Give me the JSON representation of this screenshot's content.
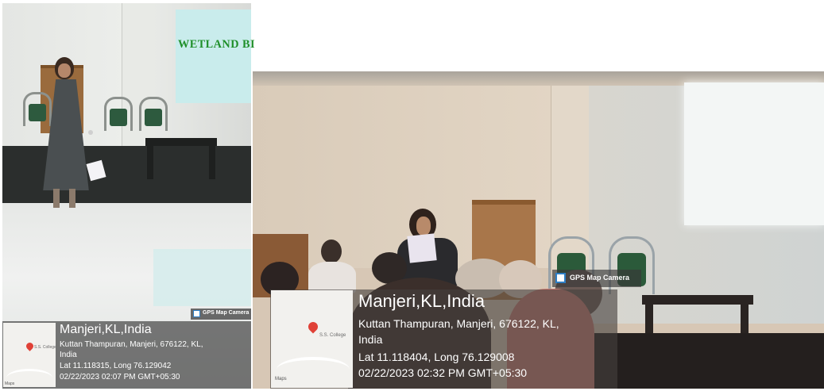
{
  "photo_left": {
    "screen_text": "WETLAND BI",
    "badge": "GPS Map Camera",
    "map_label": "S.S. College",
    "maps_brand": "Maps",
    "location": "Manjeri,KL,India",
    "address_line1": "Kuttan Thampuran, Manjeri, 676122, KL,",
    "address_line2": "India",
    "coords": "Lat 11.118315, Long 76.129042",
    "timestamp": "02/22/2023 02:07 PM GMT+05:30"
  },
  "photo_right": {
    "badge": "GPS Map Camera",
    "map_label": "S.S. College",
    "maps_brand": "Maps",
    "location": "Manjeri,KL,India",
    "address_line1": "Kuttan Thampuran, Manjeri, 676122, KL,",
    "address_line2": "India",
    "coords": "Lat 11.118404, Long 76.129008",
    "timestamp": "02/22/2023 02:32 PM GMT+05:30"
  }
}
